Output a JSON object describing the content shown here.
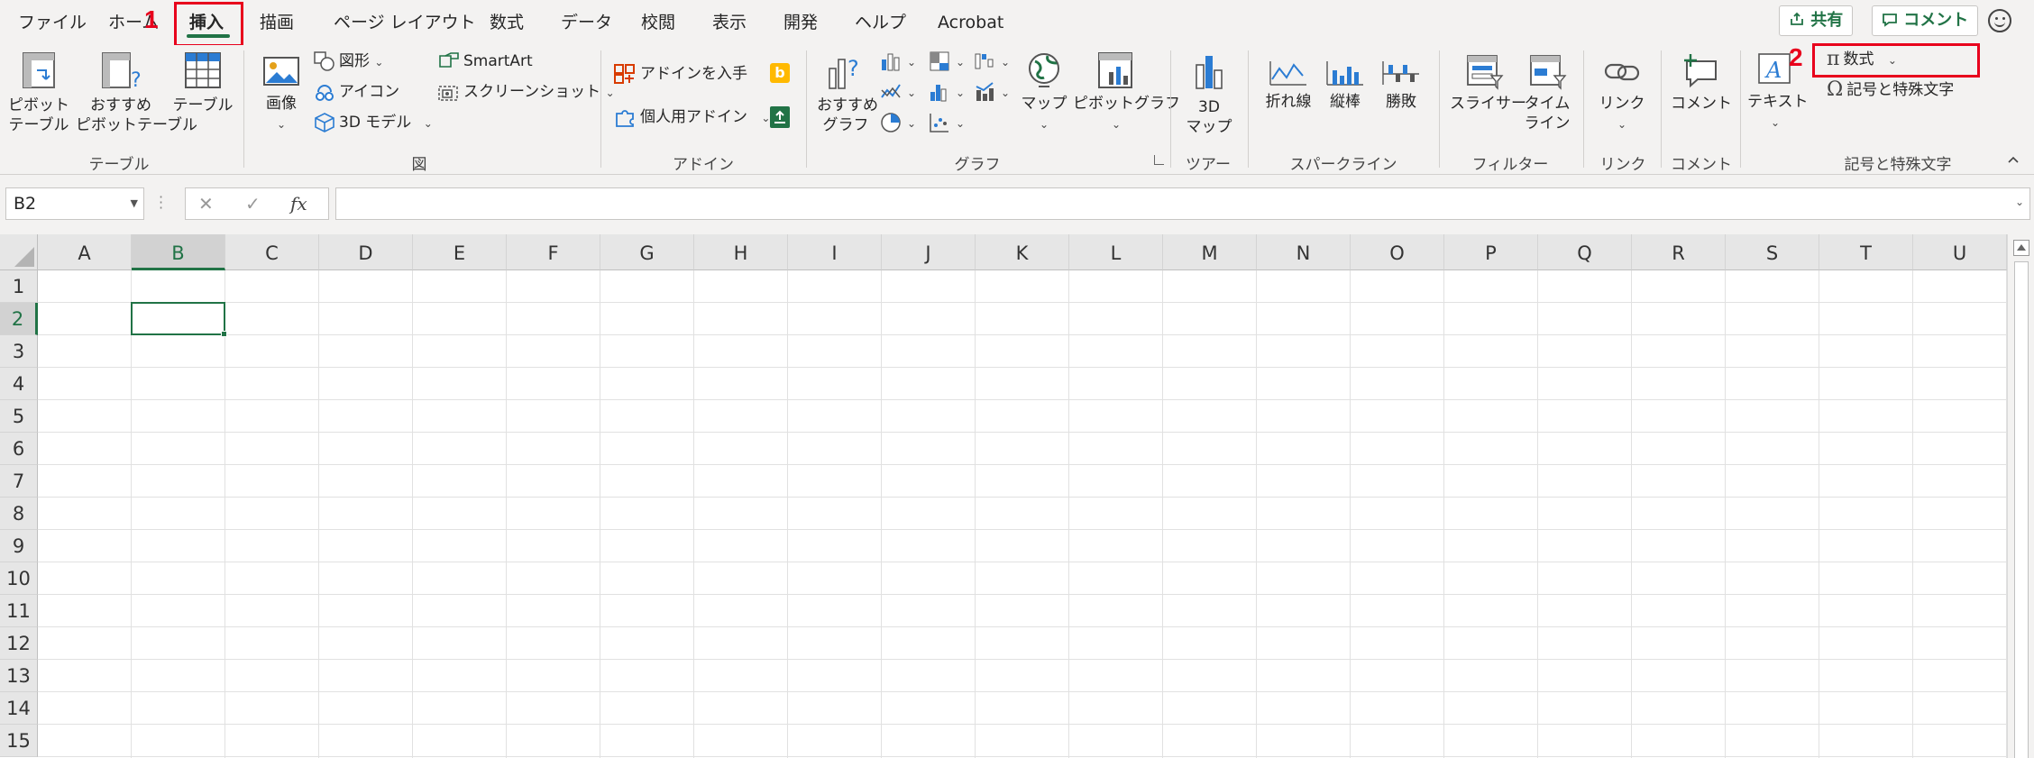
{
  "tabs": [
    {
      "id": "file",
      "label": "ファイル"
    },
    {
      "id": "home",
      "label": "ホーム"
    },
    {
      "id": "insert",
      "label": "挿入",
      "active": true
    },
    {
      "id": "draw",
      "label": "描画"
    },
    {
      "id": "pagelayout",
      "label": "ページ レイアウト"
    },
    {
      "id": "formulas",
      "label": "数式"
    },
    {
      "id": "data",
      "label": "データ"
    },
    {
      "id": "review",
      "label": "校閲"
    },
    {
      "id": "view",
      "label": "表示"
    },
    {
      "id": "developer",
      "label": "開発"
    },
    {
      "id": "help",
      "label": "ヘルプ"
    },
    {
      "id": "acrobat",
      "label": "Acrobat"
    }
  ],
  "top_buttons": {
    "share": "共有",
    "comment": "コメント"
  },
  "annotations": {
    "step1": "1",
    "step2": "2"
  },
  "ribbon": {
    "tables": {
      "pivot_table": "ピボット\nテーブル",
      "pivot_table_l1": "ピボット",
      "pivot_table_l2": "テーブル",
      "recommended_pivot_l1": "おすすめ",
      "recommended_pivot_l2": "ピボットテーブル",
      "table": "テーブル",
      "group": "テーブル"
    },
    "illustrations": {
      "image": "画像",
      "shapes": "図形",
      "icons": "アイコン",
      "models3d": "3D モデル",
      "smartart": "SmartArt",
      "screenshot": "スクリーンショット",
      "group": "図"
    },
    "addins": {
      "get_addins": "アドインを入手",
      "my_addins": "個人用アドイン",
      "group": "アドイン"
    },
    "charts": {
      "recommended_l1": "おすすめ",
      "recommended_l2": "グラフ",
      "maps": "マップ",
      "pivot_chart": "ピボットグラフ",
      "group": "グラフ"
    },
    "tours": {
      "map3d_l1": "3D",
      "map3d_l2": "マップ",
      "group": "ツアー"
    },
    "sparklines": {
      "line": "折れ線",
      "column": "縦棒",
      "winloss": "勝敗",
      "group": "スパークライン"
    },
    "filters": {
      "slicer": "スライサー",
      "timeline_l1": "タイム",
      "timeline_l2": "ライン",
      "group": "フィルター"
    },
    "links": {
      "link": "リンク",
      "group": "リンク"
    },
    "comments": {
      "comment": "コメント",
      "group": "コメント"
    },
    "text": {
      "text": "テキスト"
    },
    "symbols": {
      "equation": "数式",
      "symbol": "記号と特殊文字",
      "group": "記号と特殊文字"
    }
  },
  "formula_bar": {
    "name_box": "B2",
    "fx": "fx",
    "formula": ""
  },
  "sheet": {
    "columns": [
      "A",
      "B",
      "C",
      "D",
      "E",
      "F",
      "G",
      "H",
      "I",
      "J",
      "K",
      "L",
      "M",
      "N",
      "O",
      "P",
      "Q",
      "R",
      "S",
      "T",
      "U"
    ],
    "rows": [
      "1",
      "2",
      "3",
      "4",
      "5",
      "6",
      "7",
      "8",
      "9",
      "10",
      "11",
      "12",
      "13",
      "14",
      "15"
    ],
    "selected_cell": "B2"
  },
  "colors": {
    "accent_green": "#217346",
    "annotation_red": "#e8001c",
    "ribbon_bg": "#f3f2f1"
  }
}
